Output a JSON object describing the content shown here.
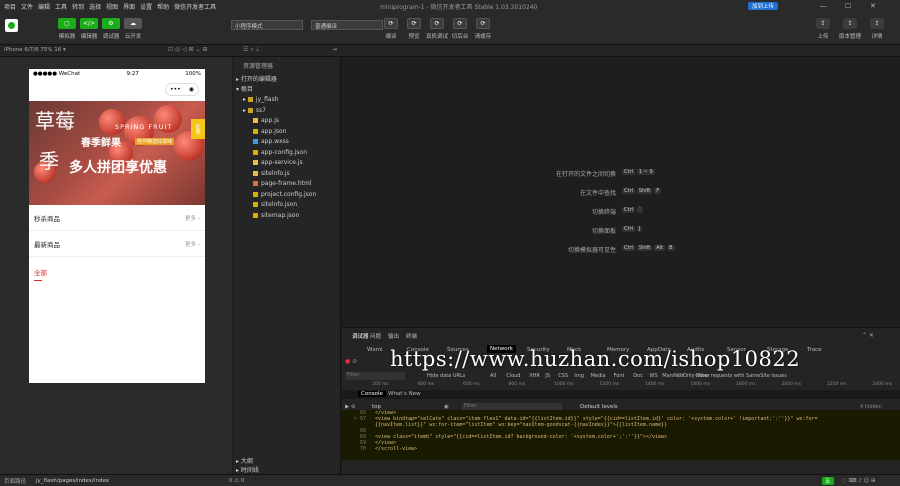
{
  "menu": [
    "项目",
    "文件",
    "编辑",
    "工具",
    "转到",
    "选择",
    "视图",
    "界面",
    "设置",
    "帮助",
    "微信开发者工具"
  ],
  "window": {
    "title": "miniprogram-1 - 微信开发者工具 Stable 1.03.2010240",
    "upload_badge": "加到上传"
  },
  "toolbar": {
    "left_buttons": [
      {
        "label": "模拟器",
        "color": "#1aad19"
      },
      {
        "label": "编辑器",
        "color": "#1aad19"
      },
      {
        "label": "调试器",
        "color": "#1aad19"
      },
      {
        "label": "云开发",
        "color": "#555555"
      }
    ],
    "mode_select": "小程序模式",
    "compile_select": "普通编译",
    "mid_buttons": [
      "编译",
      "预览",
      "真机调试",
      "切后台",
      "清缓存"
    ],
    "right_buttons": [
      "上传",
      "版本管理",
      "详情"
    ]
  },
  "sim": {
    "device": "iPhone 6/7/8 75% 16 ▾"
  },
  "phone": {
    "carrier": "●●●●● WeChat",
    "time": "9:27",
    "battery": "100%",
    "banner": {
      "big1": "草莓",
      "big2": "季",
      "en": "SPRING FRUIT",
      "sub": "春季鲜果",
      "tag": "佳作精选好滋味",
      "slogan": "多人拼团享优惠",
      "side": "优惠"
    },
    "rows": [
      {
        "label": "秒杀商品",
        "more": "更多 ›"
      },
      {
        "label": "最新商品",
        "more": "更多 ›"
      }
    ],
    "tab": "全部"
  },
  "explorer": {
    "title": "资源管理器",
    "section_open": "打开的编辑器",
    "section_root": "根目",
    "items": [
      {
        "name": "jy_flash",
        "type": "folder"
      },
      {
        "name": "ss7",
        "type": "folder"
      },
      {
        "name": "app.js",
        "type": "js"
      },
      {
        "name": "app.json",
        "type": "json"
      },
      {
        "name": "app.wxss",
        "type": "wxss"
      },
      {
        "name": "app-config.json",
        "type": "json"
      },
      {
        "name": "app-service.js",
        "type": "js"
      },
      {
        "name": "sitelnfo.js",
        "type": "js"
      },
      {
        "name": "page-frame.html",
        "type": "html"
      },
      {
        "name": "project.config.json",
        "type": "json"
      },
      {
        "name": "sitelnfo.json",
        "type": "json"
      },
      {
        "name": "sitemap.json",
        "type": "json"
      }
    ],
    "outline": "大纲",
    "timeline": "时间线"
  },
  "shortcuts": [
    {
      "label": "在打开的文件之间切换",
      "keys": [
        "Ctrl",
        "1 ~ 9"
      ]
    },
    {
      "label": "在文件中查找",
      "keys": [
        "Ctrl",
        "Shift",
        "F"
      ]
    },
    {
      "label": "切换终端",
      "keys": [
        "Ctrl",
        "`"
      ]
    },
    {
      "label": "切换面板",
      "keys": [
        "Ctrl",
        "J"
      ]
    },
    {
      "label": "切换模拟器可见性",
      "keys": [
        "Ctrl",
        "Shift",
        "Alt",
        "B"
      ]
    }
  ],
  "devtools": {
    "top_tabs": [
      "调试器",
      "问题",
      "输出",
      "终端"
    ],
    "panels": [
      "Wxml",
      "Console",
      "Sources",
      "Network",
      "Security",
      "Mock",
      "Memory",
      "AppData",
      "Audits",
      "Sensor",
      "Storage",
      "Trace"
    ],
    "active_panel": "Network",
    "filter_placeholder": "Filter",
    "filters": [
      "Hide data URLs",
      "All",
      "Cloud",
      "XHR",
      "JS",
      "CSS",
      "Img",
      "Media",
      "Font",
      "Doc",
      "WS",
      "Manifest",
      "Other"
    ],
    "only_show": "Only show requests with SameSite issues",
    "timeline": [
      "200 ms",
      "400 ms",
      "600 ms",
      "800 ms",
      "1000 ms",
      "1200 ms",
      "1400 ms",
      "1600 ms",
      "1800 ms",
      "2000 ms",
      "2200 ms",
      "2400 ms"
    ],
    "console_tabs": [
      "Console",
      "What's New"
    ],
    "context": "top",
    "levels": "Default levels",
    "issues": "4 hidden"
  },
  "code": [
    {
      "ln": "65",
      "text": "        </view>"
    },
    {
      "ln": "> 67",
      "text": "        <view bindtap=\"selCate\" class=\"item flex1\" data-id=\"{{listItem.id}}\" style=\"{{cid==listItem.id}' color: '+system.color+' !important;':''}}\" wx:for="
    },
    {
      "ln": "",
      "text": "  {{navItem.list}}\" wx:for-item=\"listItem\" wx:key=\"navItem-goodscat-{{navIndex}}\">{{listItem.name}}"
    },
    {
      "ln": "68",
      "text": ""
    },
    {
      "ln": "69",
      "text": "            <view class=\"itemb\" style=\"{{cid==listItem.id? background-color: '+system.color+';':''}}\"></view>"
    },
    {
      "ln": "69",
      "text": "        </view>"
    },
    {
      "ln": "70",
      "text": "      </scroll-view>"
    }
  ],
  "statusbar": {
    "path_label": "页面路径",
    "path": "jy_flash/pages/index/index",
    "errors": "0 ⚠ 0"
  },
  "watermark": "https://www.huzhan.com/ishop10822",
  "tray": "五"
}
